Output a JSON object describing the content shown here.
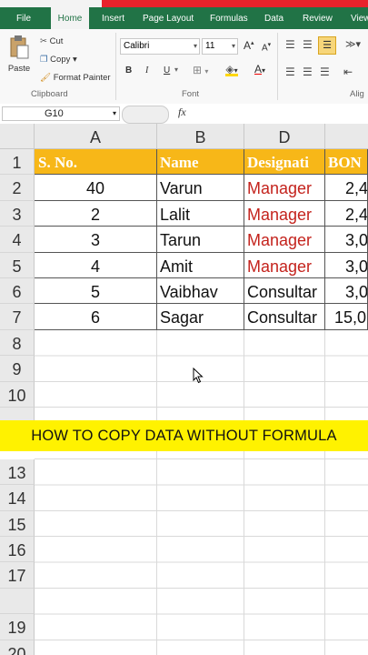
{
  "ribbon": {
    "tabs": [
      "File",
      "Home",
      "Insert",
      "Page Layout",
      "Formulas",
      "Data",
      "Review",
      "View"
    ],
    "clipboard": {
      "paste": "Paste",
      "cut": "Cut",
      "copy": "Copy",
      "format_painter": "Format Painter",
      "label": "Clipboard"
    },
    "font": {
      "name": "Calibri",
      "size": "11",
      "label": "Font",
      "bold": "B",
      "italic": "I",
      "underline": "U",
      "grow": "A",
      "shrink": "A",
      "font_color": "A"
    },
    "alignment": {
      "label": "Alig"
    }
  },
  "formula_bar": {
    "name_box": "G10",
    "fx": "fx"
  },
  "columns": [
    "A",
    "B",
    "D",
    ""
  ],
  "rows": [
    "1",
    "2",
    "3",
    "4",
    "5",
    "6",
    "7",
    "8",
    "9",
    "10",
    "13",
    "14",
    "15",
    "16",
    "17",
    "19",
    "20"
  ],
  "table": {
    "headers": [
      "S. No.",
      "Name",
      "Designati",
      "BON"
    ],
    "data": [
      [
        "40",
        "Varun",
        "Manager",
        "2,4"
      ],
      [
        "2",
        "Lalit",
        "Manager",
        "2,4"
      ],
      [
        "3",
        "Tarun",
        "Manager",
        "3,0"
      ],
      [
        "4",
        "Amit",
        "Manager",
        "3,0"
      ],
      [
        "5",
        "Vaibhav",
        "Consultar",
        "3,0"
      ],
      [
        "6",
        "Sagar",
        "Consultar",
        "15,0"
      ]
    ]
  },
  "banner": "HOW TO COPY DATA WITHOUT FORMULA",
  "colors": {
    "excel_green": "#217346",
    "header_fill": "#f7b718",
    "manager_red": "#c4231d",
    "banner_yellow": "#fff200"
  }
}
